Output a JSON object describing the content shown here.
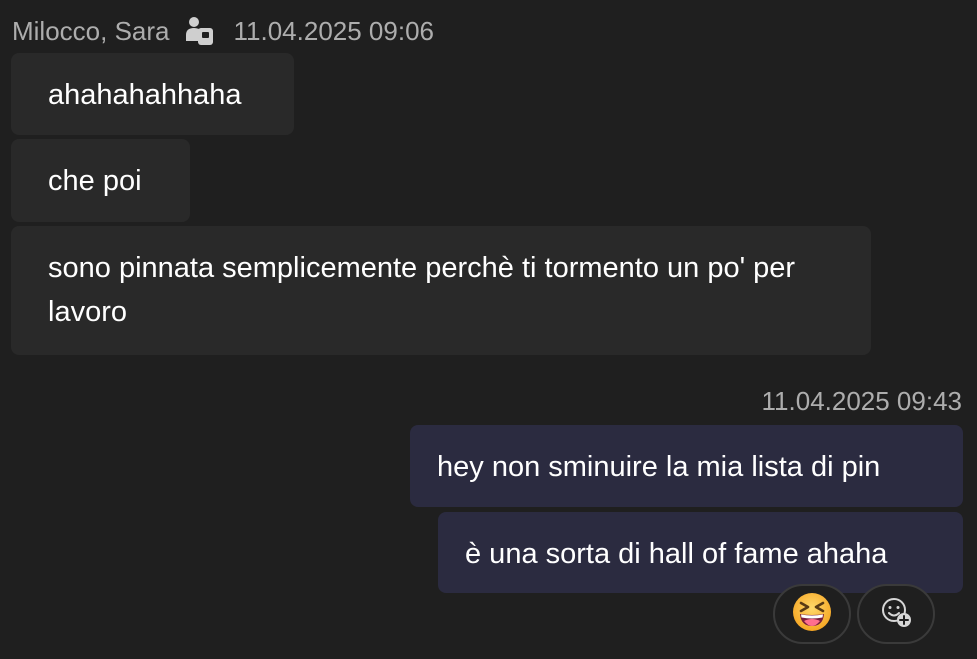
{
  "incoming": {
    "sender": "Milocco, Sara",
    "timestamp": "11.04.2025 09:06",
    "status_icon": "org-external-icon",
    "messages": [
      "ahahahahhaha",
      "che poi",
      "sono pinnata semplicemente perchè ti tormento un po' per lavoro"
    ]
  },
  "outgoing": {
    "timestamp": "11.04.2025 09:43",
    "messages": [
      "hey non sminuire la mia lista di pin",
      "è una sorta di hall of fame ahaha"
    ]
  },
  "reactions": {
    "existing": "laughing-squinting-face-emoji",
    "add": "add-reaction-icon"
  },
  "colors": {
    "background": "#1f1f1f",
    "incoming_bubble": "#292929",
    "outgoing_bubble": "#2b2b40",
    "meta_text": "#adadad"
  }
}
